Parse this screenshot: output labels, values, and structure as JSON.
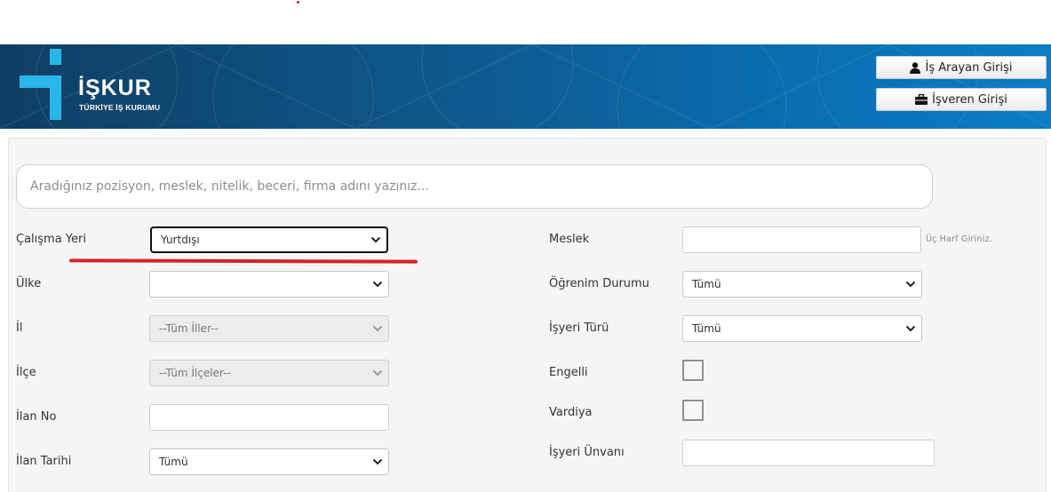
{
  "header": {
    "logo_name": "İŞKUR",
    "logo_subtitle": "TÜRKİYE İŞ KURUMU",
    "buttons": {
      "job_seeker_login": "İş Arayan Girişi",
      "employer_login": "İşveren Girişi"
    },
    "colors": {
      "bar_start": "#0f3e63",
      "bar_end": "#0b7dc4",
      "logo_cyan": "#29b6e8"
    }
  },
  "search": {
    "placeholder": "Aradığınız pozisyon, meslek, nitelik, beceri, firma adını yazınız..."
  },
  "left": {
    "calisma_yeri": {
      "label": "Çalışma Yeri",
      "value": "Yurtdışı"
    },
    "ulke": {
      "label": "Ülke",
      "value": ""
    },
    "il": {
      "label": "İl",
      "value": "--Tüm İller--"
    },
    "ilce": {
      "label": "İlçe",
      "value": "--Tüm İlçeler--"
    },
    "ilan_no": {
      "label": "İlan No",
      "value": ""
    },
    "ilan_tarihi": {
      "label": "İlan Tarihi",
      "value": "Tümü"
    }
  },
  "right": {
    "meslek": {
      "label": "Meslek",
      "value": "",
      "hint": "Üç Harf Giriniz."
    },
    "ogrenim": {
      "label": "Öğrenim Durumu",
      "value": "Tümü"
    },
    "isyeri_turu": {
      "label": "İşyeri Türü",
      "value": "Tümü"
    },
    "engelli": {
      "label": "Engelli",
      "checked": false
    },
    "vardiya": {
      "label": "Vardiya",
      "checked": false
    },
    "isyeri_unvani": {
      "label": "İşyeri Ünvanı",
      "value": ""
    }
  },
  "annotation": {
    "underline_color": "#d9202a"
  }
}
